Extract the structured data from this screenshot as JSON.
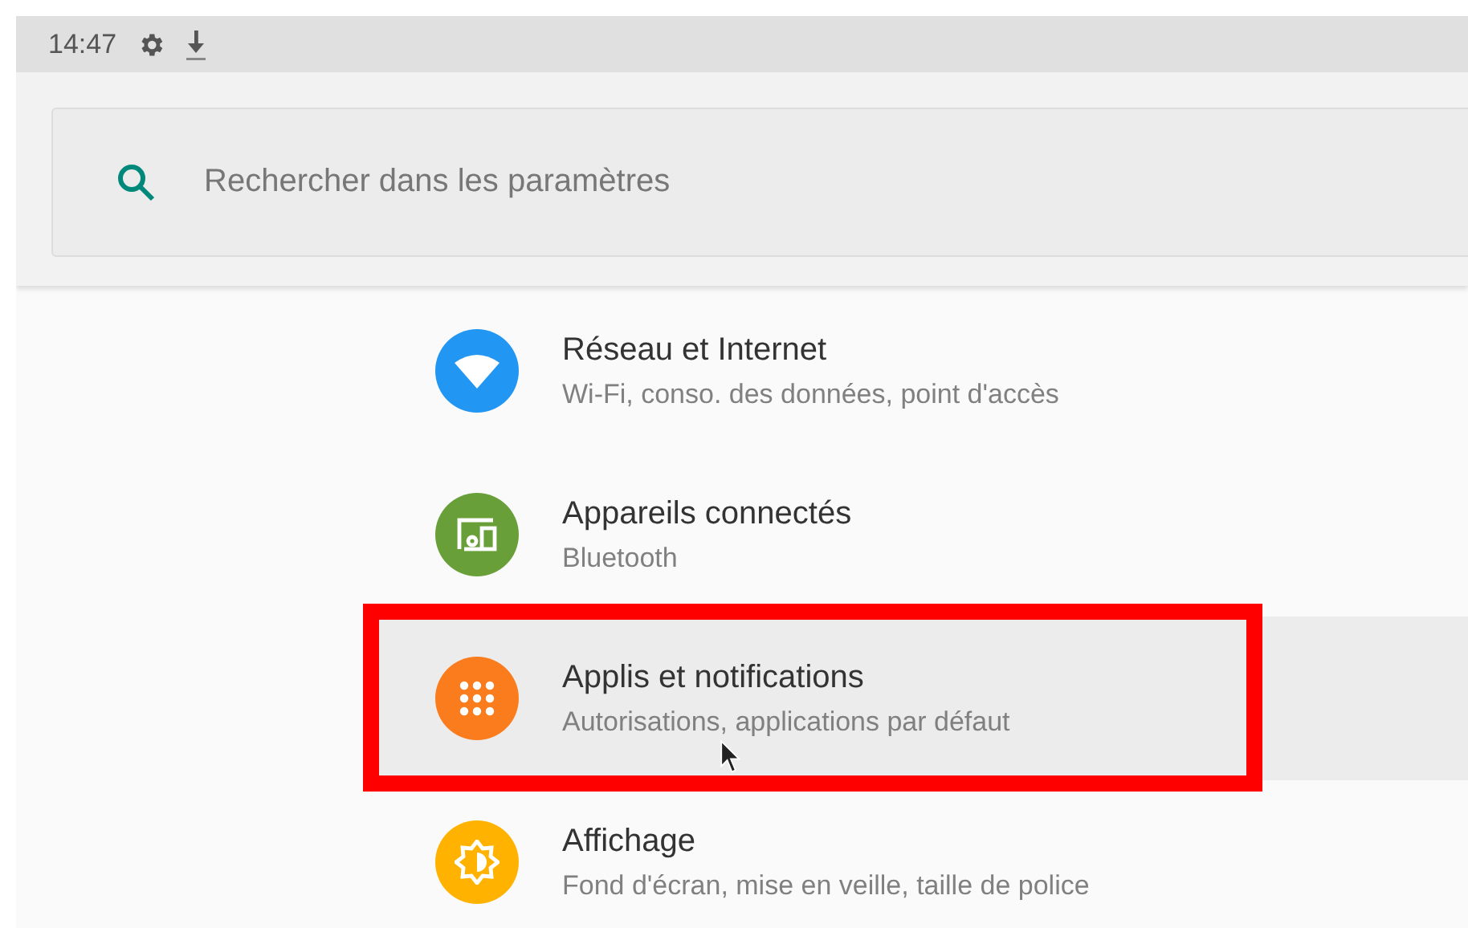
{
  "status_bar": {
    "time": "14:47"
  },
  "search": {
    "placeholder": "Rechercher dans les paramètres"
  },
  "items": [
    {
      "kind": "network",
      "title": "Réseau et Internet",
      "subtitle": "Wi-Fi, conso. des données, point d'accès",
      "color": "#2196f3",
      "selected": false,
      "outlined": false
    },
    {
      "kind": "devices",
      "title": "Appareils connectés",
      "subtitle": "Bluetooth",
      "color": "#689f38",
      "selected": false,
      "outlined": false
    },
    {
      "kind": "apps",
      "title": "Applis et notifications",
      "subtitle": "Autorisations, applications par défaut",
      "color": "#fb7c1d",
      "selected": true,
      "outlined": true
    },
    {
      "kind": "display",
      "title": "Affichage",
      "subtitle": "Fond d'écran, mise en veille, taille de police",
      "color": "#ffb300",
      "selected": false,
      "outlined": false
    }
  ]
}
